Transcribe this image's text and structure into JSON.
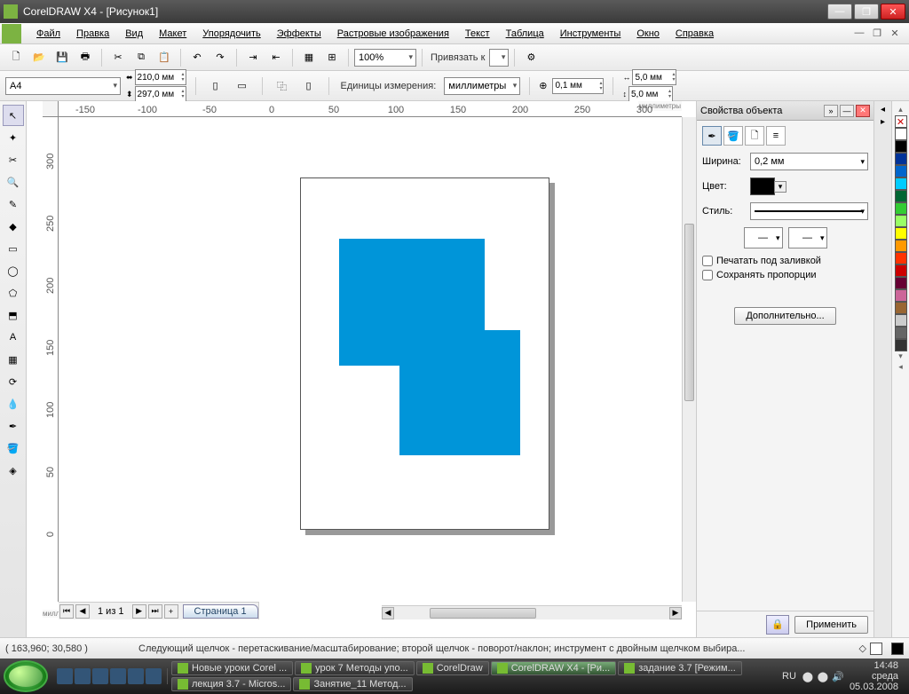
{
  "title": "CorelDRAW X4 - [Рисунок1]",
  "menu": [
    "Файл",
    "Правка",
    "Вид",
    "Макет",
    "Упорядочить",
    "Эффекты",
    "Растровые изображения",
    "Текст",
    "Таблица",
    "Инструменты",
    "Окно",
    "Справка"
  ],
  "toolbar": {
    "zoom": "100%",
    "snap_label": "Привязать к"
  },
  "propbar": {
    "paper": "A4",
    "width": "210,0 мм",
    "height": "297,0 мм",
    "units_label": "Единицы измерения:",
    "units": "миллиметры",
    "nudge": "0,1 мм",
    "dupx": "5,0 мм",
    "dupy": "5,0 мм"
  },
  "ruler": {
    "h_unit": "миллиметры",
    "v_unit": "миллиметры",
    "hticks": [
      "-150",
      "-100",
      "-50",
      "0",
      "50",
      "100",
      "150",
      "200",
      "250",
      "300"
    ],
    "vticks": [
      "300",
      "250",
      "200",
      "150",
      "100",
      "50",
      "0"
    ]
  },
  "pagenav": {
    "info": "1 из 1",
    "tab": "Страница 1"
  },
  "docker": {
    "title": "Свойства объекта",
    "width_label": "Ширина:",
    "width_val": "0,2 мм",
    "color_label": "Цвет:",
    "style_label": "Стиль:",
    "print_under": "Печатать под заливкой",
    "keep_prop": "Сохранять пропорции",
    "advanced": "Дополнительно...",
    "apply": "Применить"
  },
  "status": {
    "coords": "( 163,960; 30,580 )",
    "hint": "Следующий щелчок - перетаскивание/масштабирование; второй щелчок - поворот/наклон; инструмент с двойным щелчком выбира..."
  },
  "palette": [
    "#ffffff",
    "#000000",
    "#003399",
    "#0066cc",
    "#00ccff",
    "#006633",
    "#33cc33",
    "#99ff66",
    "#ffff00",
    "#ff9900",
    "#ff3300",
    "#cc0000",
    "#660033",
    "#cc6699",
    "#996633",
    "#cccccc",
    "#666666",
    "#333333"
  ],
  "taskbar": {
    "apps": [
      "Новые уроки Corel ...",
      "урок 7 Методы упо...",
      "CorelDraw",
      "CorelDRAW X4 - [Ри...",
      "задание 3.7 [Режим...",
      "лекция 3.7 - Micros...",
      "Занятие_11 Метод..."
    ],
    "lang": "RU",
    "time": "14:48",
    "day": "среда",
    "date": "05.03.2008"
  }
}
